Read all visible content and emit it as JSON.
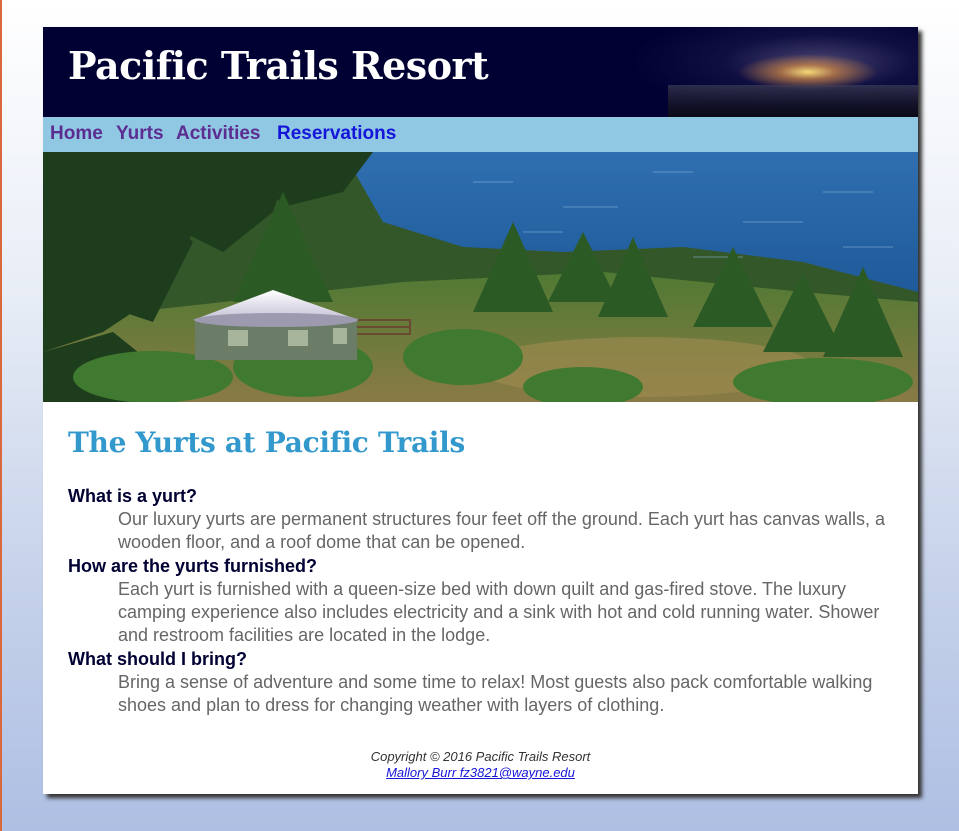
{
  "header": {
    "title": "Pacific Trails Resort"
  },
  "nav": {
    "items": [
      {
        "label": "Home"
      },
      {
        "label": "Yurts"
      },
      {
        "label": "Activities"
      },
      {
        "label": "Reservations"
      }
    ]
  },
  "hero": {
    "alt": "Yurt overlooking the Pacific Ocean"
  },
  "main": {
    "heading": "The Yurts at Pacific Trails",
    "faq": [
      {
        "question": "What is a yurt?",
        "answer": "Our luxury yurts are permanent structures four feet off the ground. Each yurt has canvas walls, a wooden floor, and a roof dome that can be opened."
      },
      {
        "question": "How are the yurts furnished?",
        "answer": "Each yurt is furnished with a queen-size bed with down quilt and gas-fired stove. The luxury camping experience also includes electricity and a sink with hot and cold running water. Shower and restroom facilities are located in the lodge."
      },
      {
        "question": "What should I bring?",
        "answer": "Bring a sense of adventure and some time to relax! Most guests also pack comfortable walking shoes and plan to dress for changing weather with layers of clothing."
      }
    ]
  },
  "footer": {
    "copyright": "Copyright © 2016 Pacific Trails Resort",
    "contact_link": "Mallory Burr fz3821@wayne.edu"
  },
  "colors": {
    "header_bg": "#000033",
    "nav_bg": "#90c7e3",
    "heading": "#3399cc",
    "question": "#000033",
    "answer": "#666666",
    "link": "#1515d9",
    "visited_link": "#5c2d91"
  }
}
